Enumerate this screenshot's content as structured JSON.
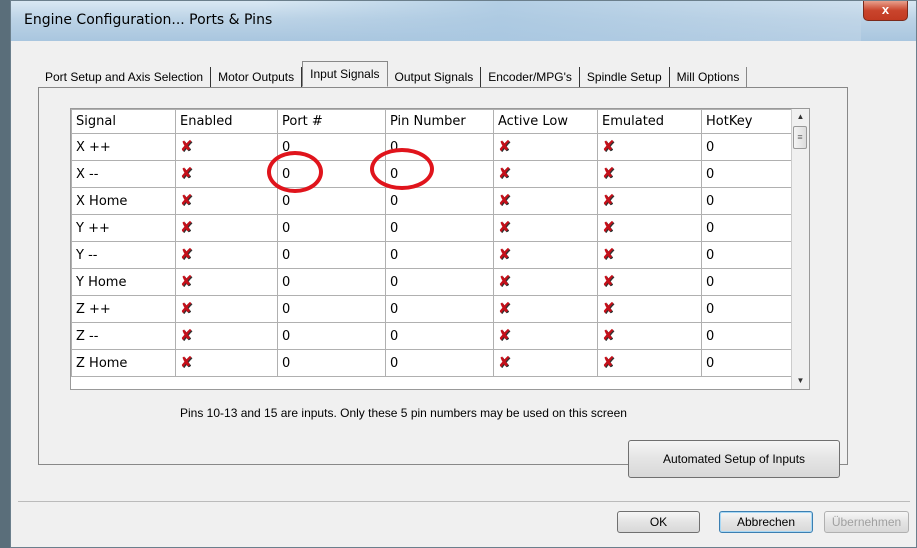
{
  "window": {
    "title": "Engine Configuration... Ports & Pins",
    "close_glyph": "x"
  },
  "tabs": [
    {
      "label": "Port Setup and Axis Selection",
      "active": false
    },
    {
      "label": "Motor Outputs",
      "active": false
    },
    {
      "label": "Input Signals",
      "active": true
    },
    {
      "label": "Output Signals",
      "active": false
    },
    {
      "label": "Encoder/MPG's",
      "active": false
    },
    {
      "label": "Spindle Setup",
      "active": false
    },
    {
      "label": "Mill Options",
      "active": false
    }
  ],
  "grid": {
    "columns": [
      "Signal",
      "Enabled",
      "Port #",
      "Pin Number",
      "Active Low",
      "Emulated",
      "HotKey"
    ],
    "rows": [
      {
        "signal": "X ++",
        "port": "0",
        "pin": "0",
        "hotkey": "0"
      },
      {
        "signal": "X --",
        "port": "0",
        "pin": "0",
        "hotkey": "0"
      },
      {
        "signal": "X Home",
        "port": "0",
        "pin": "0",
        "hotkey": "0"
      },
      {
        "signal": "Y ++",
        "port": "0",
        "pin": "0",
        "hotkey": "0"
      },
      {
        "signal": "Y --",
        "port": "0",
        "pin": "0",
        "hotkey": "0"
      },
      {
        "signal": "Y Home",
        "port": "0",
        "pin": "0",
        "hotkey": "0"
      },
      {
        "signal": "Z ++",
        "port": "0",
        "pin": "0",
        "hotkey": "0"
      },
      {
        "signal": "Z --",
        "port": "0",
        "pin": "0",
        "hotkey": "0"
      },
      {
        "signal": "Z Home",
        "port": "0",
        "pin": "0",
        "hotkey": "0"
      }
    ],
    "disabled_mark": "✘",
    "mark_color": "#c4101a"
  },
  "note": "Pins 10-13 and 15 are inputs. Only these 5 pin numbers may be used on this screen",
  "buttons": {
    "auto_setup": "Automated Setup of Inputs",
    "ok": "OK",
    "cancel": "Abbrechen",
    "apply": "Übernehmen"
  },
  "highlight_color": "#e0141c"
}
